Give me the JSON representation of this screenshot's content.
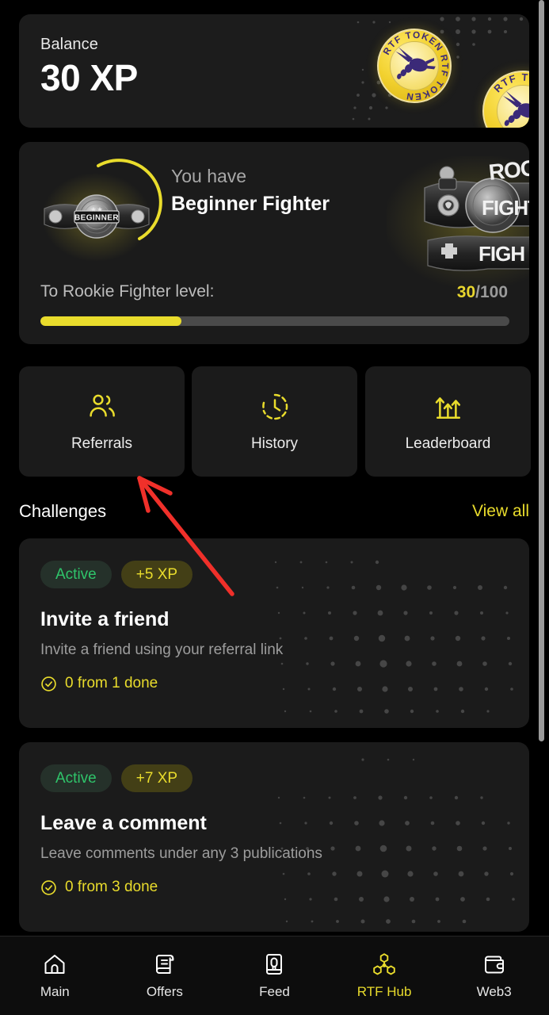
{
  "balance": {
    "label": "Balance",
    "value": "30 XP",
    "coin_text": "RTF TOKEN"
  },
  "rank": {
    "have_label": "You have",
    "current_rank": "Beginner Fighter",
    "badge_text": "BEGINNER",
    "next_badge_text": "ROOKIE FIGHTER",
    "goal_label": "To Rookie Fighter level:",
    "progress_current": "30",
    "progress_total": "/100",
    "progress_percent": 30
  },
  "quick_actions": [
    {
      "label": "Referrals",
      "icon": "users-icon"
    },
    {
      "label": "History",
      "icon": "clock-history-icon"
    },
    {
      "label": "Leaderboard",
      "icon": "bar-arrows-icon"
    }
  ],
  "challenges": {
    "title": "Challenges",
    "view_all": "View all",
    "items": [
      {
        "status": "Active",
        "reward": "+5 XP",
        "title": "Invite a friend",
        "description": "Invite a friend using your referral link",
        "progress": "0 from 1 done"
      },
      {
        "status": "Active",
        "reward": "+7 XP",
        "title": "Leave a comment",
        "description": "Leave comments under any 3 publications",
        "progress": "0 from 3 done"
      }
    ]
  },
  "bottom_nav": {
    "items": [
      {
        "label": "Main",
        "icon": "home-icon",
        "active": false
      },
      {
        "label": "Offers",
        "icon": "scroll-icon",
        "active": false
      },
      {
        "label": "Feed",
        "icon": "glove-card-icon",
        "active": false
      },
      {
        "label": "RTF Hub",
        "icon": "hex-nodes-icon",
        "active": true
      },
      {
        "label": "Web3",
        "icon": "wallet-icon",
        "active": false
      }
    ]
  },
  "colors": {
    "accent_yellow": "#e9dc2c",
    "status_green": "#2fc46a",
    "card_bg": "#1b1b1b",
    "page_bg": "#000000",
    "annotation_red": "#f0302a"
  }
}
